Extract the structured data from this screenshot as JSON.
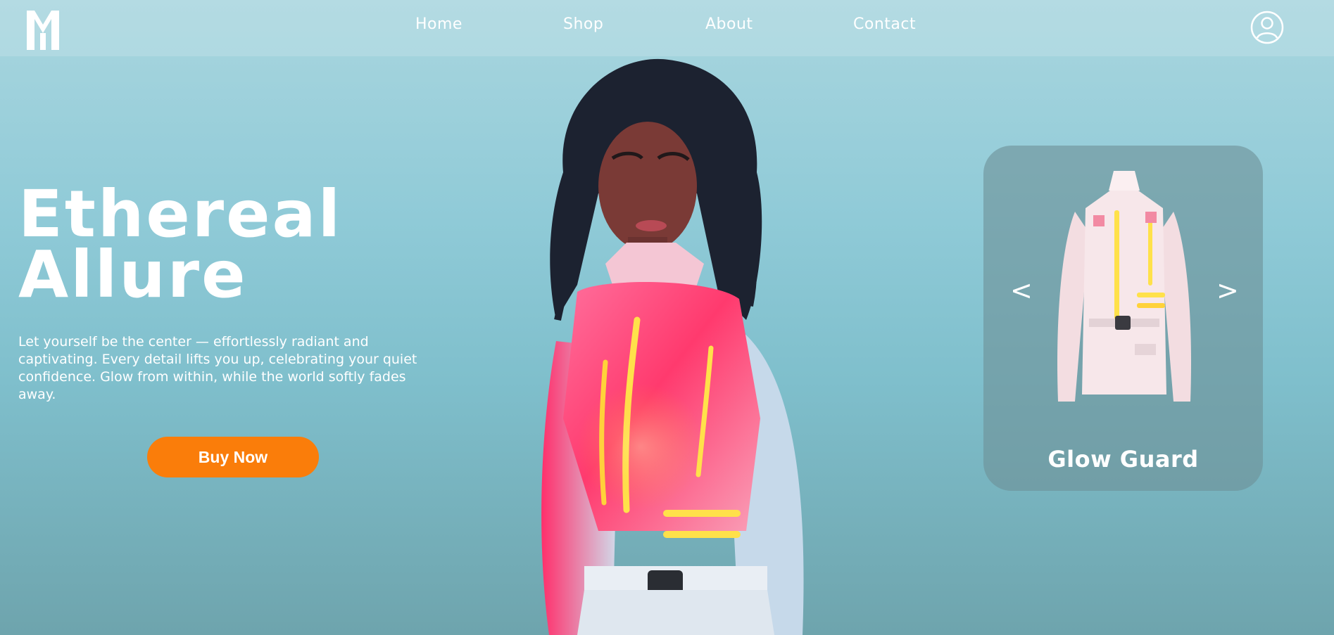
{
  "header": {
    "logo_icon": "m-monogram-logo",
    "nav": [
      {
        "label": "Home"
      },
      {
        "label": "Shop"
      },
      {
        "label": "About"
      },
      {
        "label": "Contact"
      }
    ],
    "account_icon": "user-account-icon"
  },
  "hero": {
    "title_line1": "Ethereal",
    "title_line2": "Allure",
    "description": "Let yourself be the center — effortlessly radiant and captivating. Every detail lifts you up, celebrating your quiet confidence. Glow from within, while the world softly fades away.",
    "cta_label": "Buy Now"
  },
  "product_card": {
    "prev_label": "<",
    "next_label": ">",
    "name": "Glow Guard"
  },
  "colors": {
    "accent": "#fa7d0a",
    "glow_pink": "#ff3a7a",
    "glow_yellow": "#ffe14a",
    "background_top": "#a9d6df",
    "background_bottom": "#6ea4ad"
  }
}
